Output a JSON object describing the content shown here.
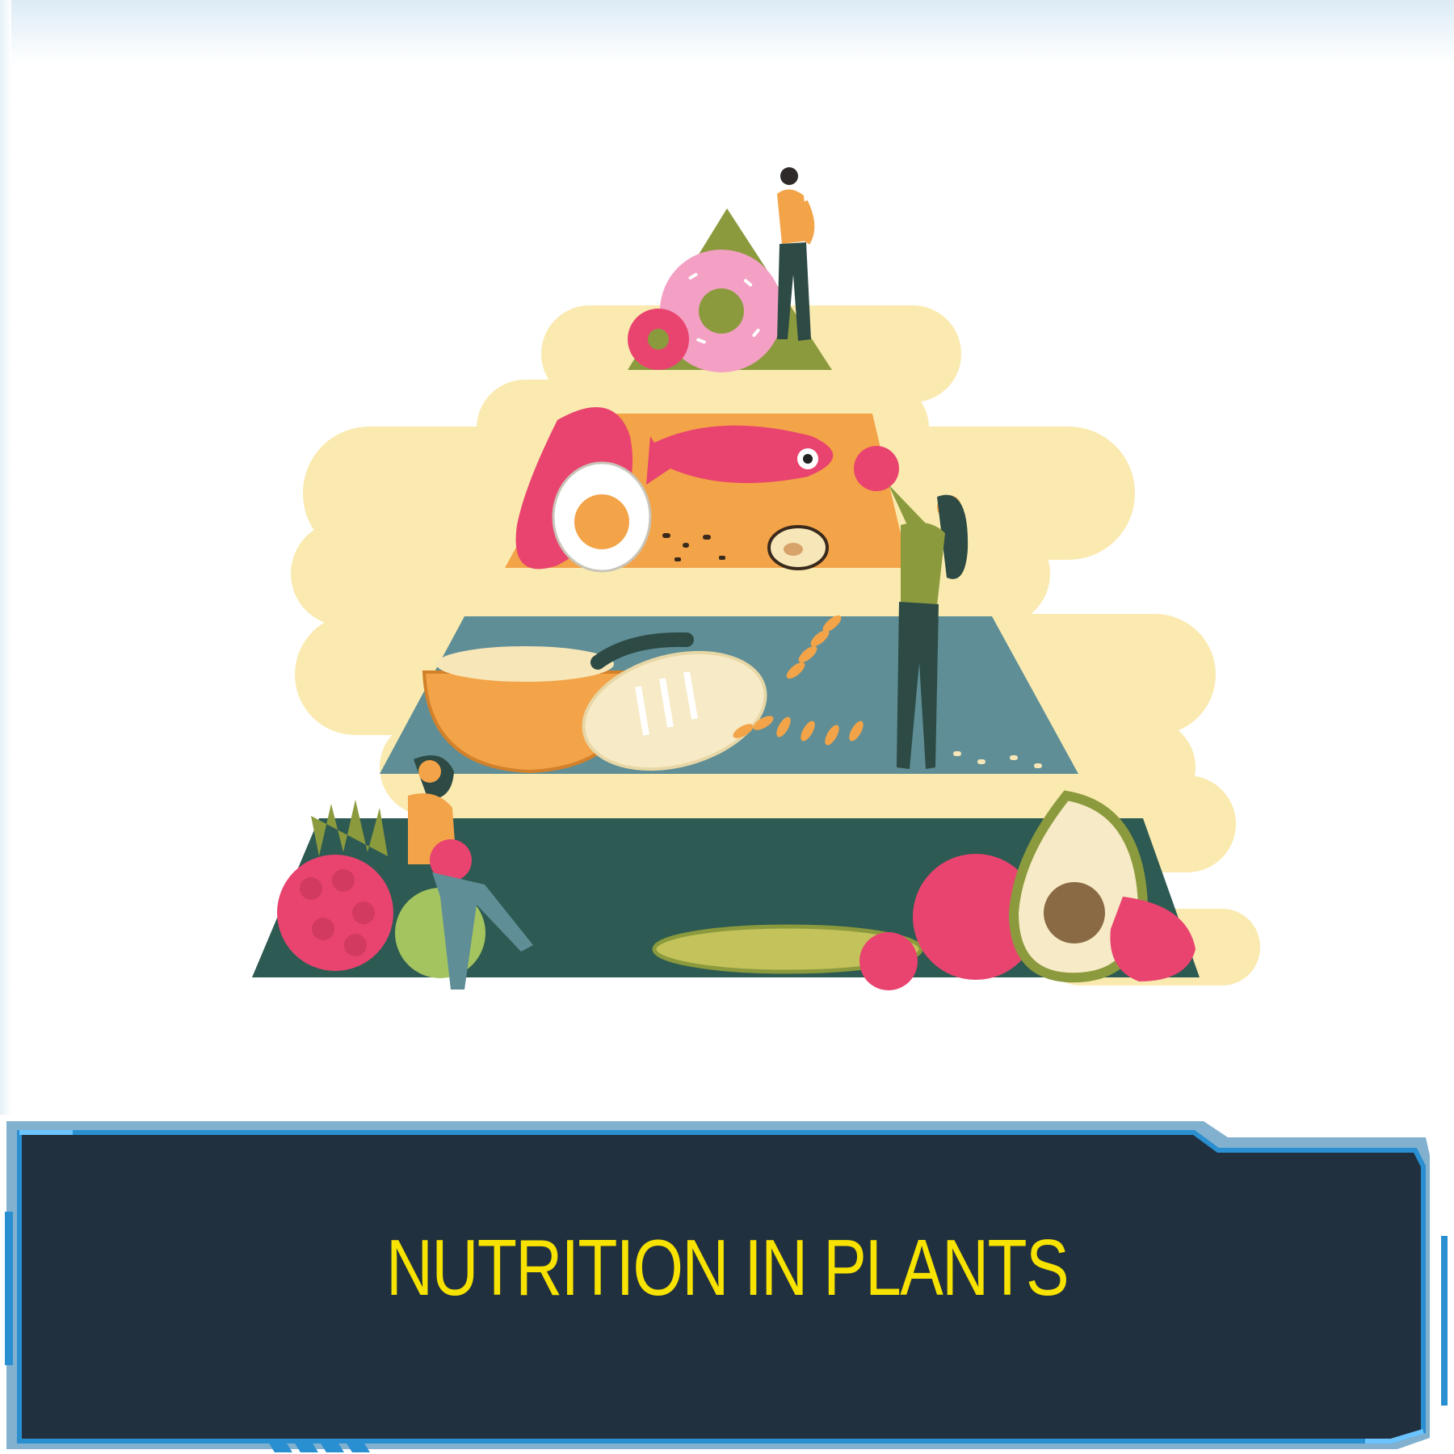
{
  "banner": {
    "title": "NUTRITION IN PLANTS"
  },
  "illustration": {
    "subject": "food-pyramid-icon",
    "tiers": [
      "sweets-tier",
      "protein-tier",
      "grains-tier",
      "fruits-vegetables-tier"
    ]
  },
  "colors": {
    "banner_fill": "#20303f",
    "banner_border": "#2a8fd0",
    "title": "#f7e200",
    "cloud": "#faeab0",
    "tier_top": "#8c9a3e",
    "tier_protein": "#f3a348",
    "tier_grains": "#5f8e96",
    "tier_base": "#2d5a52"
  }
}
